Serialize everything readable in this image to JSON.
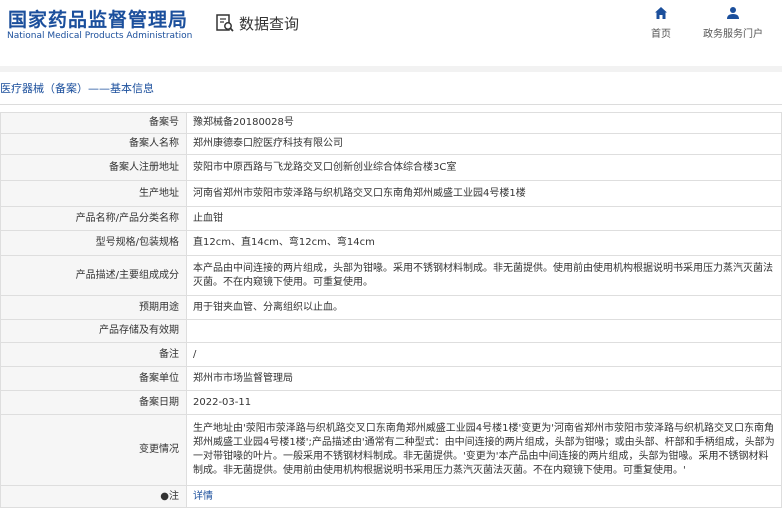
{
  "header": {
    "logo_cn": "国家药品监督管理局",
    "logo_en": "National Medical Products Administration",
    "query_label": "数据查询",
    "nav": [
      {
        "label": "首页",
        "icon": "home-icon"
      },
      {
        "label": "政务服务门户",
        "icon": "user-icon"
      }
    ]
  },
  "breadcrumb": "医疗器械（备案）——基本信息",
  "rows": [
    {
      "label": "备案号",
      "value": "豫郑械备20180028号"
    },
    {
      "label": "备案人名称",
      "value": "郑州康德泰口腔医疗科技有限公司"
    },
    {
      "label": "备案人注册地址",
      "value": "荥阳市中原西路与飞龙路交叉口创新创业综合体综合楼3C室"
    },
    {
      "label": "生产地址",
      "value": "河南省郑州市荥阳市荥泽路与织机路交叉口东南角郑州威盛工业园4号楼1楼"
    },
    {
      "label": "产品名称/产品分类名称",
      "value": "止血钳"
    },
    {
      "label": "型号规格/包装规格",
      "value": "直12cm、直14cm、弯12cm、弯14cm"
    },
    {
      "label": "产品描述/主要组成成分",
      "value": "本产品由中间连接的两片组成，头部为钳喙。采用不锈钢材料制成。非无菌提供。使用前由使用机构根据说明书采用压力蒸汽灭菌法灭菌。不在内窥镜下使用。可重复使用。"
    },
    {
      "label": "预期用途",
      "value": "用于钳夹血管、分离组织以止血。"
    },
    {
      "label": "产品存储及有效期",
      "value": ""
    },
    {
      "label": "备注",
      "value": "/"
    },
    {
      "label": "备案单位",
      "value": "郑州市市场监督管理局"
    },
    {
      "label": "备案日期",
      "value": "2022-03-11"
    },
    {
      "label": "变更情况",
      "value": "生产地址由'荥阳市荥泽路与织机路交叉口东南角郑州威盛工业园4号楼1楼'变更为'河南省郑州市荥阳市荥泽路与织机路交叉口东南角郑州威盛工业园4号楼1楼';产品描述由'通常有二种型式：由中间连接的两片组成，头部为钳喙；或由头部、杆部和手柄组成，头部为一对带钳喙的叶片。一般采用不锈钢材料制成。非无菌提供。'变更为'本产品由中间连接的两片组成，头部为钳喙。采用不锈钢材料制成。非无菌提供。使用前由使用机构根据说明书采用压力蒸汽灭菌法灭菌。不在内窥镜下使用。可重复使用。'"
    },
    {
      "label": "●注",
      "value": "详情"
    }
  ]
}
